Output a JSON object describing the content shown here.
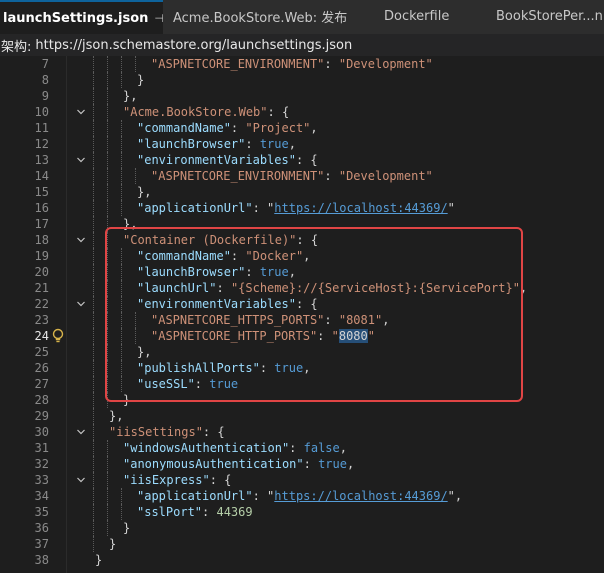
{
  "tabs": [
    {
      "label": "launchSettings.json",
      "pin": "⊣",
      "close": "✕"
    },
    {
      "label": "Acme.BookStore.Web: 发布"
    },
    {
      "label": "Dockerfile"
    },
    {
      "label": "BookStorePer...nPro"
    }
  ],
  "schema": {
    "label": "架构:",
    "url": "https://json.schemastore.org/launchsettings.json"
  },
  "editor": {
    "current_line": 24,
    "lines": [
      {
        "n": "7",
        "indent": 4,
        "tokens": [
          [
            "s",
            "\"ASPNETCORE_ENVIRONMENT\""
          ],
          [
            "p",
            ": "
          ],
          [
            "s",
            "\"Development\""
          ]
        ]
      },
      {
        "n": "8",
        "indent": 3,
        "tokens": [
          [
            "p",
            "}"
          ]
        ]
      },
      {
        "n": "9",
        "indent": 2,
        "tokens": [
          [
            "p",
            "},"
          ]
        ]
      },
      {
        "n": "10",
        "indent": 2,
        "fold": true,
        "tokens": [
          [
            "s",
            "\"Acme.BookStore.Web\""
          ],
          [
            "p",
            ": {"
          ]
        ]
      },
      {
        "n": "11",
        "indent": 3,
        "tokens": [
          [
            "k",
            "\"commandName\""
          ],
          [
            "p",
            ": "
          ],
          [
            "s",
            "\"Project\""
          ],
          [
            "p",
            ","
          ]
        ]
      },
      {
        "n": "12",
        "indent": 3,
        "tokens": [
          [
            "k",
            "\"launchBrowser\""
          ],
          [
            "p",
            ": "
          ],
          [
            "b",
            "true"
          ],
          [
            "p",
            ","
          ]
        ]
      },
      {
        "n": "13",
        "indent": 3,
        "fold": true,
        "tokens": [
          [
            "k",
            "\"environmentVariables\""
          ],
          [
            "p",
            ": {"
          ]
        ]
      },
      {
        "n": "14",
        "indent": 4,
        "tokens": [
          [
            "s",
            "\"ASPNETCORE_ENVIRONMENT\""
          ],
          [
            "p",
            ": "
          ],
          [
            "s",
            "\"Development\""
          ]
        ]
      },
      {
        "n": "15",
        "indent": 3,
        "tokens": [
          [
            "p",
            "},"
          ]
        ]
      },
      {
        "n": "16",
        "indent": 3,
        "tokens": [
          [
            "k",
            "\"applicationUrl\""
          ],
          [
            "p",
            ": \""
          ],
          [
            "u",
            "https://localhost:44369/"
          ],
          [
            "p",
            "\""
          ]
        ]
      },
      {
        "n": "17",
        "indent": 2,
        "tokens": [
          [
            "p",
            "},"
          ]
        ]
      },
      {
        "n": "18",
        "indent": 2,
        "fold": true,
        "tokens": [
          [
            "s",
            "\"Container (Dockerfile)\""
          ],
          [
            "p",
            ": {"
          ]
        ]
      },
      {
        "n": "19",
        "indent": 3,
        "tokens": [
          [
            "k",
            "\"commandName\""
          ],
          [
            "p",
            ": "
          ],
          [
            "s",
            "\"Docker\""
          ],
          [
            "p",
            ","
          ]
        ]
      },
      {
        "n": "20",
        "indent": 3,
        "tokens": [
          [
            "k",
            "\"launchBrowser\""
          ],
          [
            "p",
            ": "
          ],
          [
            "b",
            "true"
          ],
          [
            "p",
            ","
          ]
        ]
      },
      {
        "n": "21",
        "indent": 3,
        "tokens": [
          [
            "k",
            "\"launchUrl\""
          ],
          [
            "p",
            ": "
          ],
          [
            "s",
            "\"{Scheme}://{ServiceHost}:{ServicePort}\""
          ],
          [
            "p",
            ","
          ]
        ]
      },
      {
        "n": "22",
        "indent": 3,
        "fold": true,
        "tokens": [
          [
            "k",
            "\"environmentVariables\""
          ],
          [
            "p",
            ": {"
          ]
        ]
      },
      {
        "n": "23",
        "indent": 4,
        "tokens": [
          [
            "s",
            "\"ASPNETCORE_HTTPS_PORTS\""
          ],
          [
            "p",
            ": "
          ],
          [
            "s",
            "\"8081\""
          ],
          [
            "p",
            ","
          ]
        ]
      },
      {
        "n": "24",
        "indent": 4,
        "tokens": [
          [
            "s",
            "\"ASPNETCORE_HTTP_PORTS\""
          ],
          [
            "p",
            ": "
          ],
          [
            "s",
            "\""
          ],
          [
            "sel",
            "8080"
          ],
          [
            "s",
            "\""
          ]
        ]
      },
      {
        "n": "25",
        "indent": 3,
        "tokens": [
          [
            "p",
            "},"
          ]
        ]
      },
      {
        "n": "26",
        "indent": 3,
        "tokens": [
          [
            "k",
            "\"publishAllPorts\""
          ],
          [
            "p",
            ": "
          ],
          [
            "b",
            "true"
          ],
          [
            "p",
            ","
          ]
        ]
      },
      {
        "n": "27",
        "indent": 3,
        "tokens": [
          [
            "k",
            "\"useSSL\""
          ],
          [
            "p",
            ": "
          ],
          [
            "b",
            "true"
          ]
        ]
      },
      {
        "n": "28",
        "indent": 2,
        "tokens": [
          [
            "p",
            "}"
          ]
        ]
      },
      {
        "n": "29",
        "indent": 1,
        "tokens": [
          [
            "p",
            "},"
          ]
        ]
      },
      {
        "n": "30",
        "indent": 1,
        "fold": true,
        "tokens": [
          [
            "s",
            "\"iisSettings\""
          ],
          [
            "p",
            ": {"
          ]
        ]
      },
      {
        "n": "31",
        "indent": 2,
        "tokens": [
          [
            "k",
            "\"windowsAuthentication\""
          ],
          [
            "p",
            ": "
          ],
          [
            "b",
            "false"
          ],
          [
            "p",
            ","
          ]
        ]
      },
      {
        "n": "32",
        "indent": 2,
        "tokens": [
          [
            "k",
            "\"anonymousAuthentication\""
          ],
          [
            "p",
            ": "
          ],
          [
            "b",
            "true"
          ],
          [
            "p",
            ","
          ]
        ]
      },
      {
        "n": "33",
        "indent": 2,
        "fold": true,
        "tokens": [
          [
            "k",
            "\"iisExpress\""
          ],
          [
            "p",
            ": {"
          ]
        ]
      },
      {
        "n": "34",
        "indent": 3,
        "tokens": [
          [
            "k",
            "\"applicationUrl\""
          ],
          [
            "p",
            ": \""
          ],
          [
            "u",
            "https://localhost:44369/"
          ],
          [
            "p",
            "\","
          ]
        ]
      },
      {
        "n": "35",
        "indent": 3,
        "tokens": [
          [
            "k",
            "\"sslPort\""
          ],
          [
            "p",
            ": "
          ],
          [
            "n",
            "44369"
          ]
        ]
      },
      {
        "n": "36",
        "indent": 2,
        "tokens": [
          [
            "p",
            "}"
          ]
        ]
      },
      {
        "n": "37",
        "indent": 1,
        "tokens": [
          [
            "p",
            "}"
          ]
        ]
      },
      {
        "n": "38",
        "indent": 0,
        "tokens": [
          [
            "p",
            "}"
          ]
        ]
      }
    ]
  },
  "colors": {
    "highlight_box": "#e04545",
    "string": "#ce9178",
    "key": "#9cdcfe",
    "keyword": "#569cd6",
    "number": "#b5cea8",
    "selection": "#264f78"
  },
  "icons": {
    "lightbulb": "lightbulb-icon",
    "fold": "chevron-down-icon"
  }
}
